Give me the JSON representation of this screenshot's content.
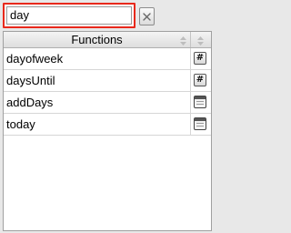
{
  "search": {
    "value": "day",
    "placeholder": ""
  },
  "clear_button": {
    "icon": "close-icon"
  },
  "table": {
    "column_header": "Functions",
    "rows": [
      {
        "name": "dayofweek",
        "type_icon": "hash-icon"
      },
      {
        "name": "daysUntil",
        "type_icon": "hash-icon"
      },
      {
        "name": "addDays",
        "type_icon": "calendar-icon"
      },
      {
        "name": "today",
        "type_icon": "calendar-icon"
      }
    ]
  },
  "colors": {
    "search_highlight": "#e8291b"
  }
}
